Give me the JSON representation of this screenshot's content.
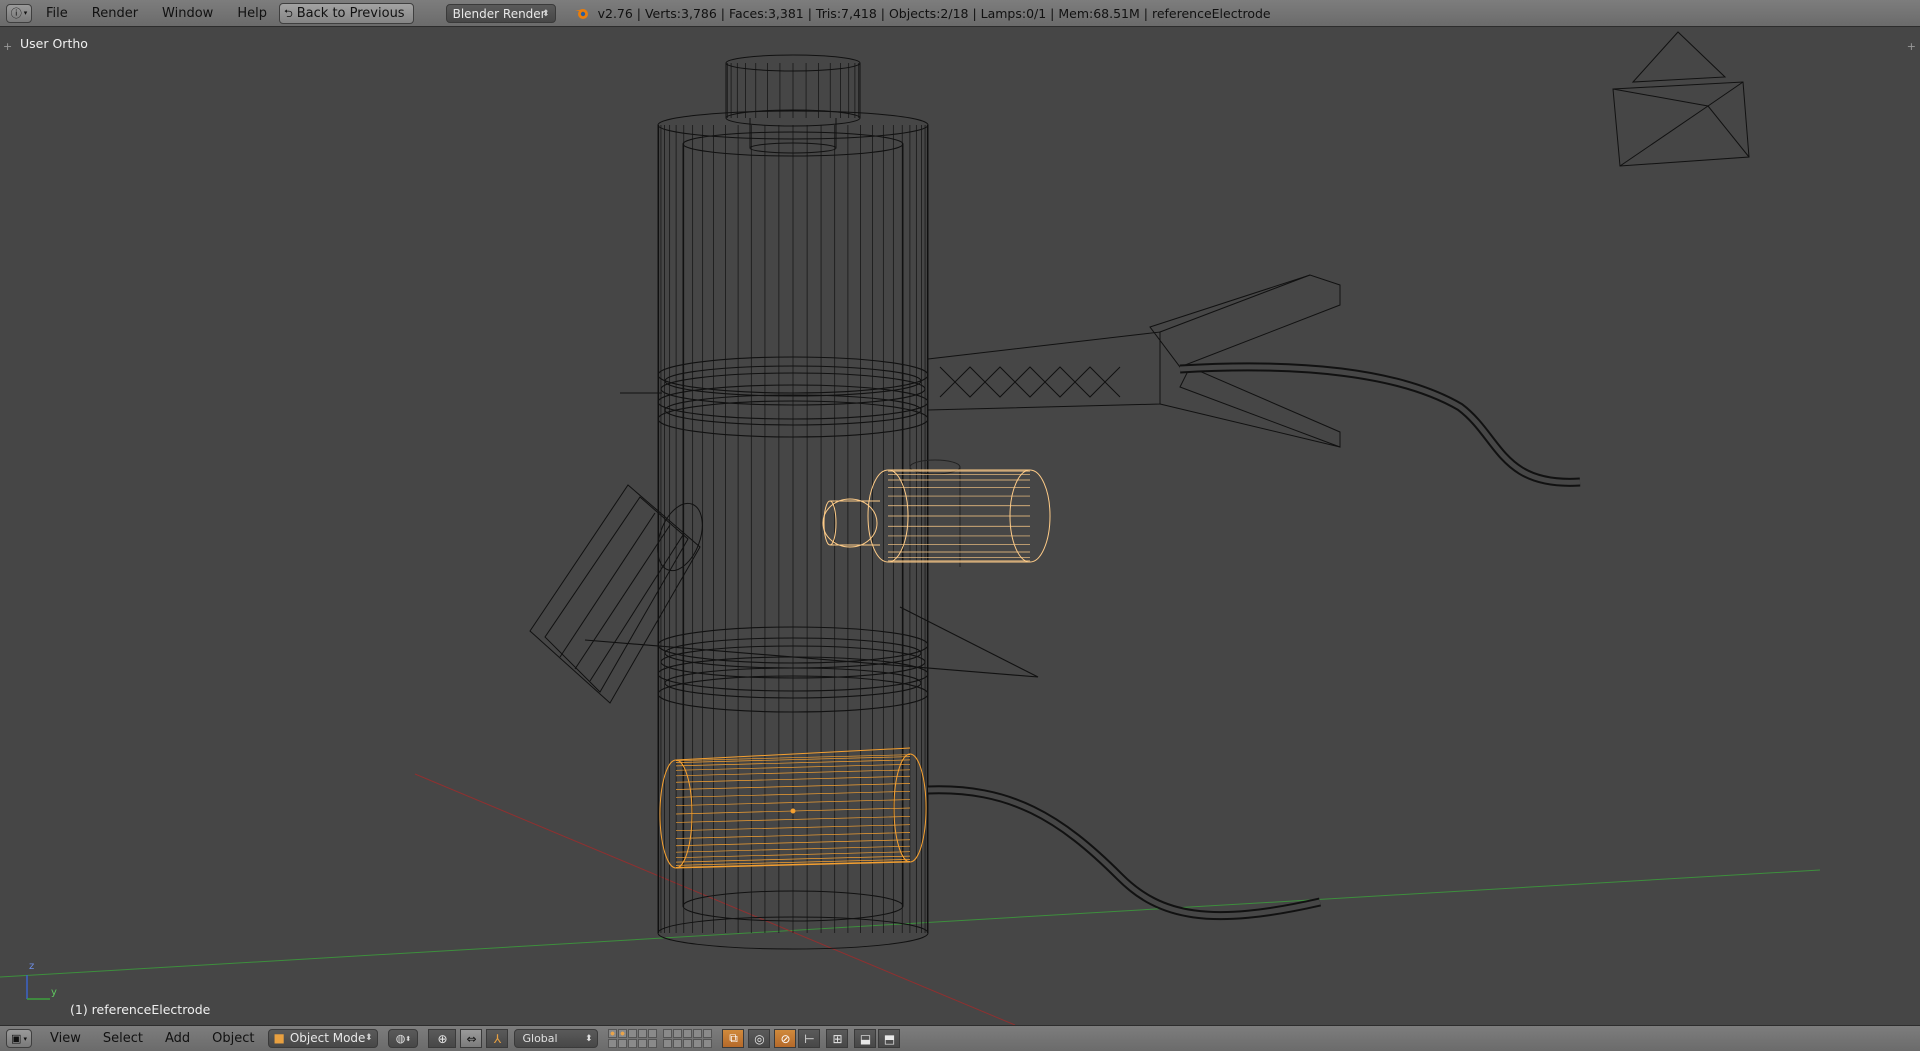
{
  "top_bar": {
    "editor_icon": "info-icon",
    "menus": [
      "File",
      "Render",
      "Window",
      "Help"
    ],
    "back_button": "Back to Previous",
    "render_engine": "Blender Render",
    "stats": "v2.76 | Verts:3,786 | Faces:3,381 | Tris:7,418 | Objects:2/18 | Lamps:0/1 | Mem:68.51M | referenceElectrode"
  },
  "viewport": {
    "view_label": "User Ortho",
    "object_label": "(1) referenceElectrode",
    "axis_labels": {
      "z": "z",
      "y": "y"
    }
  },
  "bottom_bar": {
    "menus": [
      "View",
      "Select",
      "Add",
      "Object"
    ],
    "mode": "Object Mode",
    "orientation": "Global"
  },
  "colors": {
    "header_bg": "#727272",
    "viewport_bg": "#464646",
    "selected_orange": "#f5a030",
    "active_orange": "#ffcc88",
    "wire_black": "#111111",
    "x_axis": "#a03030",
    "y_axis": "#40a040"
  }
}
